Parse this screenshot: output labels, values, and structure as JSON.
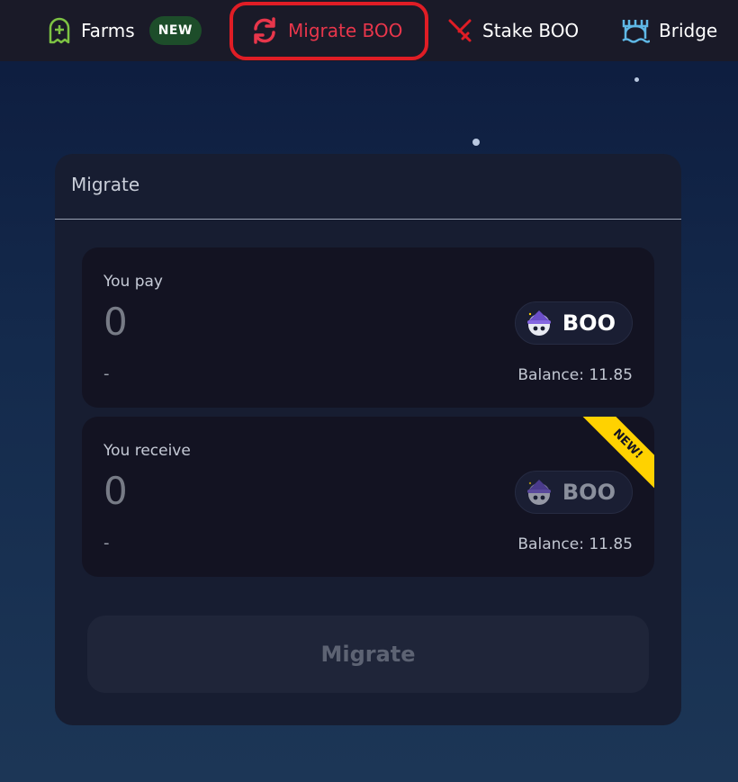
{
  "nav": {
    "farms": {
      "label": "Farms",
      "badge": "NEW",
      "icon": "ghost-plus-icon"
    },
    "migrate": {
      "label": "Migrate BOO",
      "icon": "refresh-icon",
      "color": "#e8364b",
      "highlight": "#e01d25"
    },
    "stake": {
      "label": "Stake BOO",
      "icon": "sword-icon"
    },
    "bridge": {
      "label": "Bridge",
      "icon": "bridge-icon"
    }
  },
  "card": {
    "title": "Migrate",
    "pay": {
      "label": "You pay",
      "amount": "0",
      "usd": "-",
      "token": "BOO",
      "balance": "Balance: 11.85"
    },
    "receive": {
      "label": "You receive",
      "amount": "0",
      "usd": "-",
      "token": "BOO",
      "balance": "Balance: 11.85",
      "ribbon": "NEW!"
    },
    "button_label": "Migrate"
  },
  "colors": {
    "accent_red": "#e8364b",
    "ribbon_yellow": "#ffd200",
    "new_pill_green": "#1d4d2a"
  }
}
